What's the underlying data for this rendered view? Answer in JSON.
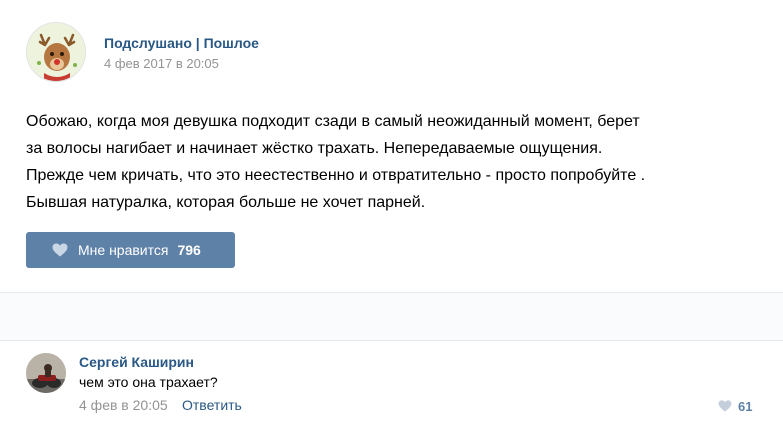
{
  "post": {
    "group_name": "Подслушано | Пошлое",
    "date": "4 фев 2017 в 20:05",
    "text_lines": [
      "Обожаю, когда моя девушка подходит сзади в самый неожиданный момент, берет",
      "за волосы нагибает и начинает жёстко трахать. Непередаваемые ощущения.",
      "Прежде чем кричать, что это неестественно и отвратительно - просто попробуйте .",
      "Бывшая натуралка, которая больше не хочет парней."
    ],
    "like_label": "Мне нравится",
    "like_count": "796",
    "like_icon": "heart-icon"
  },
  "comment": {
    "author": "Сергей Каширин",
    "text": "чем это она трахает?",
    "date": "4 фев в 20:05",
    "reply_label": "Ответить",
    "like_count": "61",
    "like_icon": "heart-icon"
  },
  "colors": {
    "link": "#2a5885",
    "muted": "#939393",
    "button": "#5e81a8",
    "divider": "#e7e8ec",
    "gap_bg": "#fafbfc"
  }
}
